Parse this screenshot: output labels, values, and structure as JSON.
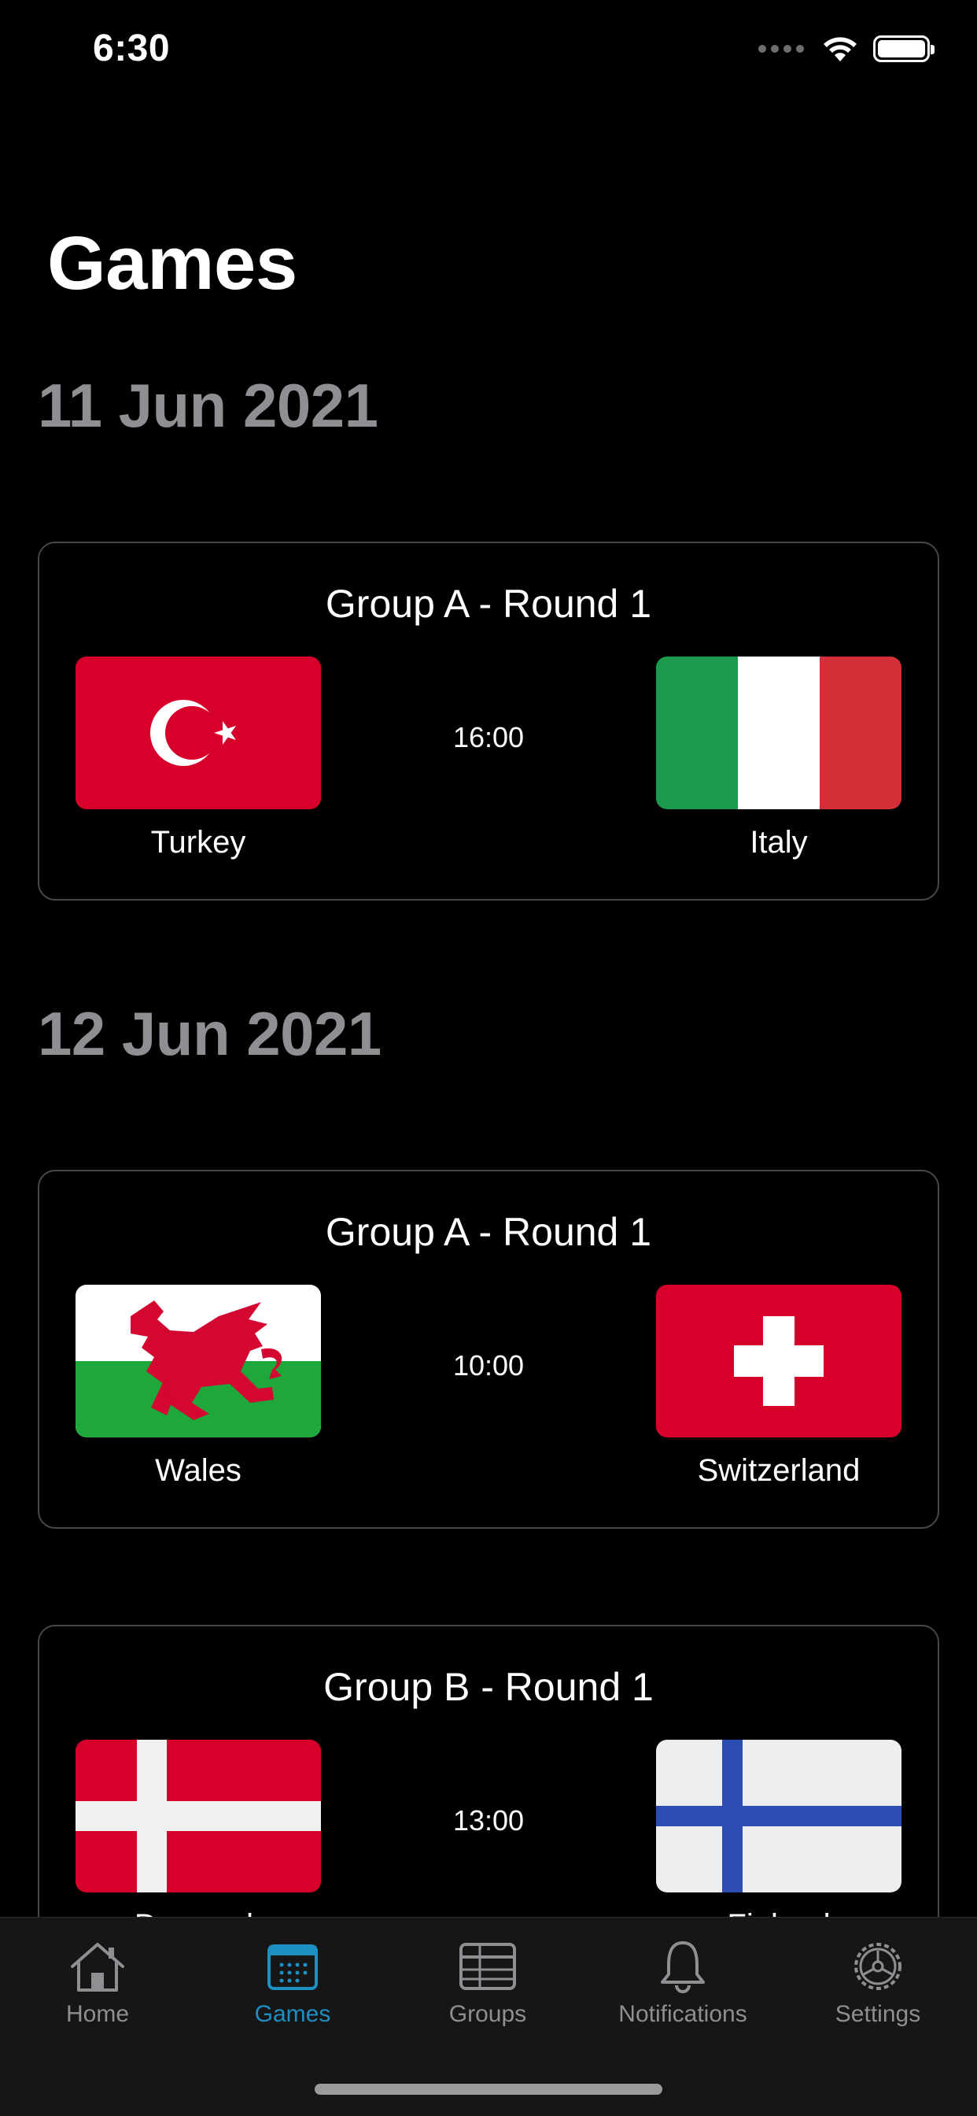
{
  "status_bar": {
    "time": "6:30"
  },
  "page": {
    "title": "Games"
  },
  "sections": [
    {
      "date": "11 Jun 2021",
      "matches": [
        {
          "title": "Group A - Round 1",
          "home": "Turkey",
          "away": "Italy",
          "time": "16:00"
        }
      ]
    },
    {
      "date": "12 Jun 2021",
      "matches": [
        {
          "title": "Group A - Round 1",
          "home": "Wales",
          "away": "Switzerland",
          "time": "10:00"
        },
        {
          "title": "Group B - Round 1",
          "home": "Denmark",
          "away": "Finland",
          "time": "13:00"
        }
      ]
    }
  ],
  "tab_bar": {
    "items": [
      {
        "label": "Home",
        "icon": "house-icon",
        "active": false
      },
      {
        "label": "Games",
        "icon": "calendar-icon",
        "active": true
      },
      {
        "label": "Groups",
        "icon": "table-grid-icon",
        "active": false
      },
      {
        "label": "Notifications",
        "icon": "bell-icon",
        "active": false
      },
      {
        "label": "Settings",
        "icon": "gear-icon",
        "active": false
      }
    ]
  },
  "colors": {
    "background": "#000000",
    "card_border": "#48484a",
    "date_heading": "#8e8e93",
    "tab_inactive": "#8e8e93",
    "tab_active": "#1e8fc2",
    "tab_bar_bg": "#161616"
  }
}
